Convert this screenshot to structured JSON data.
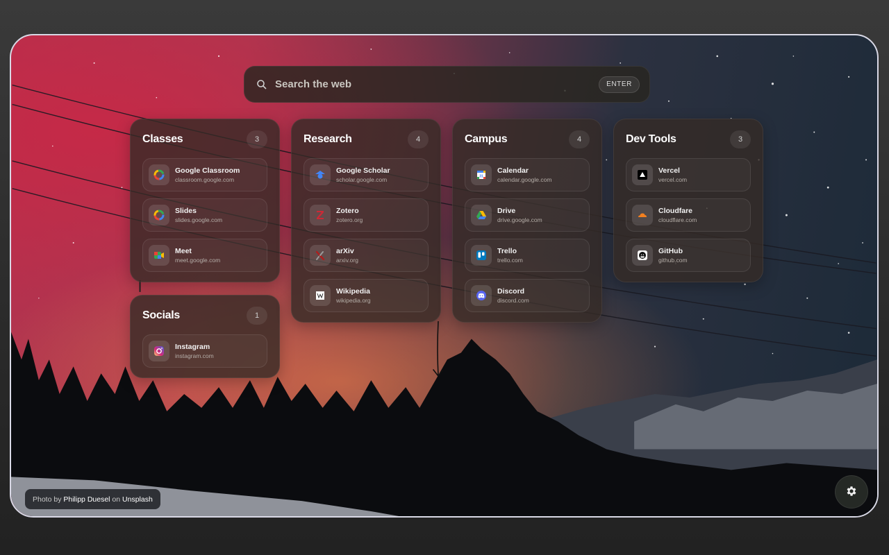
{
  "search": {
    "placeholder": "Search the web",
    "enter_label": "ENTER"
  },
  "groups": [
    {
      "title": "Classes",
      "count": "3",
      "links": [
        {
          "name": "Google Classroom",
          "url": "classroom.google.com",
          "icon": "google-icon"
        },
        {
          "name": "Slides",
          "url": "slides.google.com",
          "icon": "google-icon"
        },
        {
          "name": "Meet",
          "url": "meet.google.com",
          "icon": "google-meet-icon"
        }
      ]
    },
    {
      "title": "Socials",
      "count": "1",
      "links": [
        {
          "name": "Instagram",
          "url": "instagram.com",
          "icon": "instagram-icon"
        }
      ]
    },
    {
      "title": "Research",
      "count": "4",
      "links": [
        {
          "name": "Google Scholar",
          "url": "scholar.google.com",
          "icon": "google-scholar-icon"
        },
        {
          "name": "Zotero",
          "url": "zotero.org",
          "icon": "zotero-icon"
        },
        {
          "name": "arXiv",
          "url": "arxiv.org",
          "icon": "arxiv-icon"
        },
        {
          "name": "Wikipedia",
          "url": "wikipedia.org",
          "icon": "wikipedia-icon"
        }
      ]
    },
    {
      "title": "Campus",
      "count": "4",
      "links": [
        {
          "name": "Calendar",
          "url": "calendar.google.com",
          "icon": "google-calendar-icon"
        },
        {
          "name": "Drive",
          "url": "drive.google.com",
          "icon": "google-drive-icon"
        },
        {
          "name": "Trello",
          "url": "trello.com",
          "icon": "trello-icon"
        },
        {
          "name": "Discord",
          "url": "discord.com",
          "icon": "discord-icon"
        }
      ]
    },
    {
      "title": "Dev Tools",
      "count": "3",
      "links": [
        {
          "name": "Vercel",
          "url": "vercel.com",
          "icon": "vercel-icon"
        },
        {
          "name": "Cloudfare",
          "url": "cloudflare.com",
          "icon": "cloudflare-icon"
        },
        {
          "name": "GitHub",
          "url": "github.com",
          "icon": "github-icon"
        }
      ]
    }
  ],
  "credit": {
    "prefix": "Photo by",
    "author": "Philipp Duesel",
    "middle": "on",
    "source": "Unsplash"
  },
  "settings": {
    "icon": "gear-icon"
  },
  "colors": {
    "accent_google_blue": "#4285F4",
    "accent_google_red": "#EA4335",
    "accent_google_yellow": "#FBBC05",
    "accent_google_green": "#34A853",
    "zotero_red": "#CC2936",
    "arxiv_red": "#B31B1B",
    "trello_blue": "#0079BF",
    "discord_blurple": "#5865F2",
    "cloudflare_orange": "#F38020"
  }
}
